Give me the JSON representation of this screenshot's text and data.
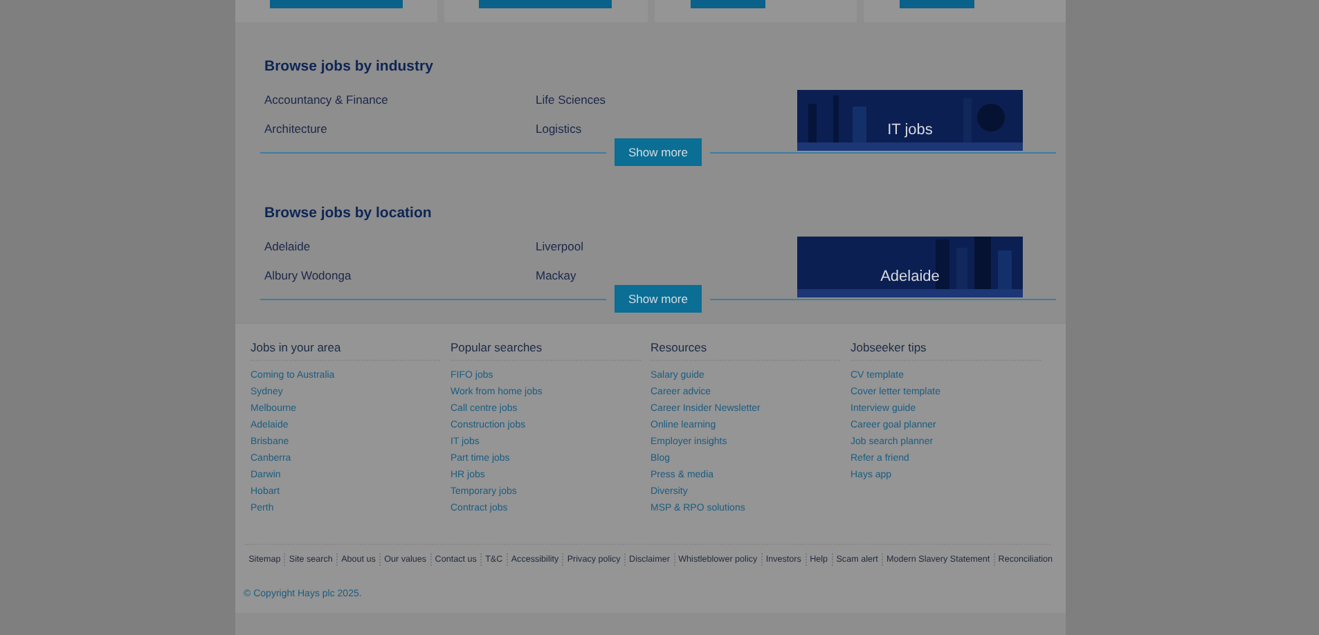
{
  "top_cards": [
    {
      "kind": "card"
    },
    {
      "kind": "card"
    },
    {
      "kind": "card"
    },
    {
      "kind": "card"
    }
  ],
  "sections": [
    {
      "title": "Browse jobs by industry",
      "columns": [
        [
          "Accountancy & Finance",
          "Architecture"
        ],
        [
          "Life Sciences",
          "Logistics"
        ]
      ],
      "feature": {
        "kind": "picture",
        "caption": "IT jobs"
      },
      "button": "Show more"
    },
    {
      "title": "Browse jobs by location",
      "columns": [
        [
          "Adelaide",
          "Albury Wodonga"
        ],
        [
          "Liverpool",
          "Mackay"
        ]
      ],
      "feature": {
        "kind": "picture",
        "caption": "Adelaide"
      },
      "button": "Show more"
    }
  ],
  "footer_columns": [
    {
      "title": "Jobs in your area",
      "links": [
        "Coming to Australia",
        "Sydney",
        "Melbourne",
        "Adelaide",
        "Brisbane",
        "Canberra",
        "Darwin",
        "Hobart",
        "Perth"
      ]
    },
    {
      "title": "Popular searches",
      "links": [
        "FIFO jobs",
        "Work from home jobs",
        "Call centre jobs",
        "Construction jobs",
        "IT jobs",
        "Part time jobs",
        "HR jobs",
        "Temporary jobs",
        "Contract jobs"
      ]
    },
    {
      "title": "Resources",
      "links": [
        "Salary guide",
        "Career advice",
        "Career Insider Newsletter",
        "Online learning",
        "Employer insights",
        "Blog",
        "Press & media",
        "Diversity",
        "MSP & RPO solutions"
      ]
    },
    {
      "title": "Jobseeker tips",
      "links": [
        "CV template",
        "Cover letter template",
        "Interview guide",
        "Career goal planner",
        "Job search planner",
        "Refer a friend",
        "Hays app"
      ]
    }
  ],
  "bottom_links": [
    "Sitemap",
    "Site search",
    "About us",
    "Our values",
    "Contact us",
    "T&C",
    "Accessibility",
    "Privacy policy",
    "Disclaimer",
    "Whistleblower policy",
    "Investors",
    "Help",
    "Scam alert",
    "Modern Slavery Statement",
    "Reconciliation"
  ],
  "copyright": "© Copyright Hays plc 2025."
}
